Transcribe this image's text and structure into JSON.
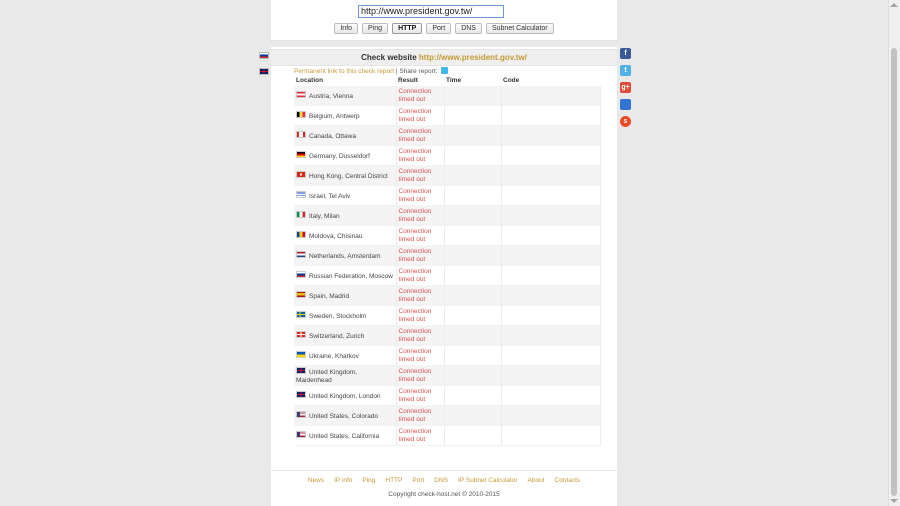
{
  "search": {
    "url": "http://www.president.gov.tw/"
  },
  "tabs": [
    {
      "label": "Info",
      "active": false
    },
    {
      "label": "Ping",
      "active": false
    },
    {
      "label": "HTTP",
      "active": true
    },
    {
      "label": "Port",
      "active": false
    },
    {
      "label": "DNS",
      "active": false
    },
    {
      "label": "Subnet Calculator",
      "active": false
    }
  ],
  "check": {
    "title_prefix": "Check website",
    "host": "http://www.president.gov.tw/",
    "permalink": "Permanent link to this check report",
    "separator": "|",
    "share_label": "Share report:"
  },
  "table": {
    "headers": [
      "Location",
      "Result",
      "Time",
      "Code"
    ],
    "rows": [
      {
        "location": "Austria, Vienna",
        "flag": "at",
        "result": "Connection timed out",
        "time": "",
        "code": ""
      },
      {
        "location": "Belgium, Antwerp",
        "flag": "be",
        "result": "Connection timed out",
        "time": "",
        "code": ""
      },
      {
        "location": "Canada, Ottawa",
        "flag": "ca",
        "result": "Connection timed out",
        "time": "",
        "code": ""
      },
      {
        "location": "Germany, Dusseldorf",
        "flag": "de",
        "result": "Connection timed out",
        "time": "",
        "code": ""
      },
      {
        "location": "Hong Kong, Central District",
        "flag": "hk",
        "result": "Connection timed out",
        "time": "",
        "code": ""
      },
      {
        "location": "Israel, Tel Aviv",
        "flag": "il",
        "result": "Connection timed out",
        "time": "",
        "code": ""
      },
      {
        "location": "Italy, Milan",
        "flag": "it",
        "result": "Connection timed out",
        "time": "",
        "code": ""
      },
      {
        "location": "Moldova, Chisinau",
        "flag": "md",
        "result": "Connection timed out",
        "time": "",
        "code": ""
      },
      {
        "location": "Netherlands, Amsterdam",
        "flag": "nl",
        "result": "Connection timed out",
        "time": "",
        "code": ""
      },
      {
        "location": "Russian Federation, Moscow",
        "flag": "ru",
        "result": "Connection timed out",
        "time": "",
        "code": ""
      },
      {
        "location": "Spain, Madrid",
        "flag": "es",
        "result": "Connection timed out",
        "time": "",
        "code": ""
      },
      {
        "location": "Sweden, Stockholm",
        "flag": "se",
        "result": "Connection timed out",
        "time": "",
        "code": ""
      },
      {
        "location": "Switzerland, Zurich",
        "flag": "ch",
        "result": "Connection timed out",
        "time": "",
        "code": ""
      },
      {
        "location": "Ukraine, Kharkov",
        "flag": "ua",
        "result": "Connection timed out",
        "time": "",
        "code": ""
      },
      {
        "location": "United Kingdom, Maidenhead",
        "flag": "gb",
        "result": "Connection timed out",
        "time": "",
        "code": ""
      },
      {
        "location": "United Kingdom, London",
        "flag": "gb",
        "result": "Connection timed out",
        "time": "",
        "code": ""
      },
      {
        "location": "United States, Colorado",
        "flag": "us",
        "result": "Connection timed out",
        "time": "",
        "code": ""
      },
      {
        "location": "United States, California",
        "flag": "us",
        "result": "Connection timed out",
        "time": "",
        "code": ""
      }
    ]
  },
  "language_flags": [
    {
      "name": "russian-flag-icon",
      "code": "ru"
    },
    {
      "name": "english-flag-icon",
      "code": "gb"
    }
  ],
  "social": [
    {
      "name": "facebook-icon",
      "glyph": "f",
      "color": "#3b5998"
    },
    {
      "name": "twitter-icon",
      "glyph": "t",
      "color": "#4fb3e8"
    },
    {
      "name": "google-plus-icon",
      "glyph": "g+",
      "color": "#dd4b39"
    },
    {
      "name": "delicious-icon",
      "glyph": "",
      "color": "#3274d1"
    },
    {
      "name": "stumbleupon-icon",
      "glyph": "s",
      "color": "#eb4924"
    }
  ],
  "footer": {
    "links": [
      "News",
      "IP info",
      "Ping",
      "HTTP",
      "Port",
      "DNS",
      "IP Subnet Calculator",
      "About",
      "Contacts"
    ],
    "copyright": "Copyright check-host.net © 2010-2015"
  },
  "colors": {
    "accent": "#c49a34",
    "error": "#d9534f",
    "input_border": "#6b98d6"
  }
}
